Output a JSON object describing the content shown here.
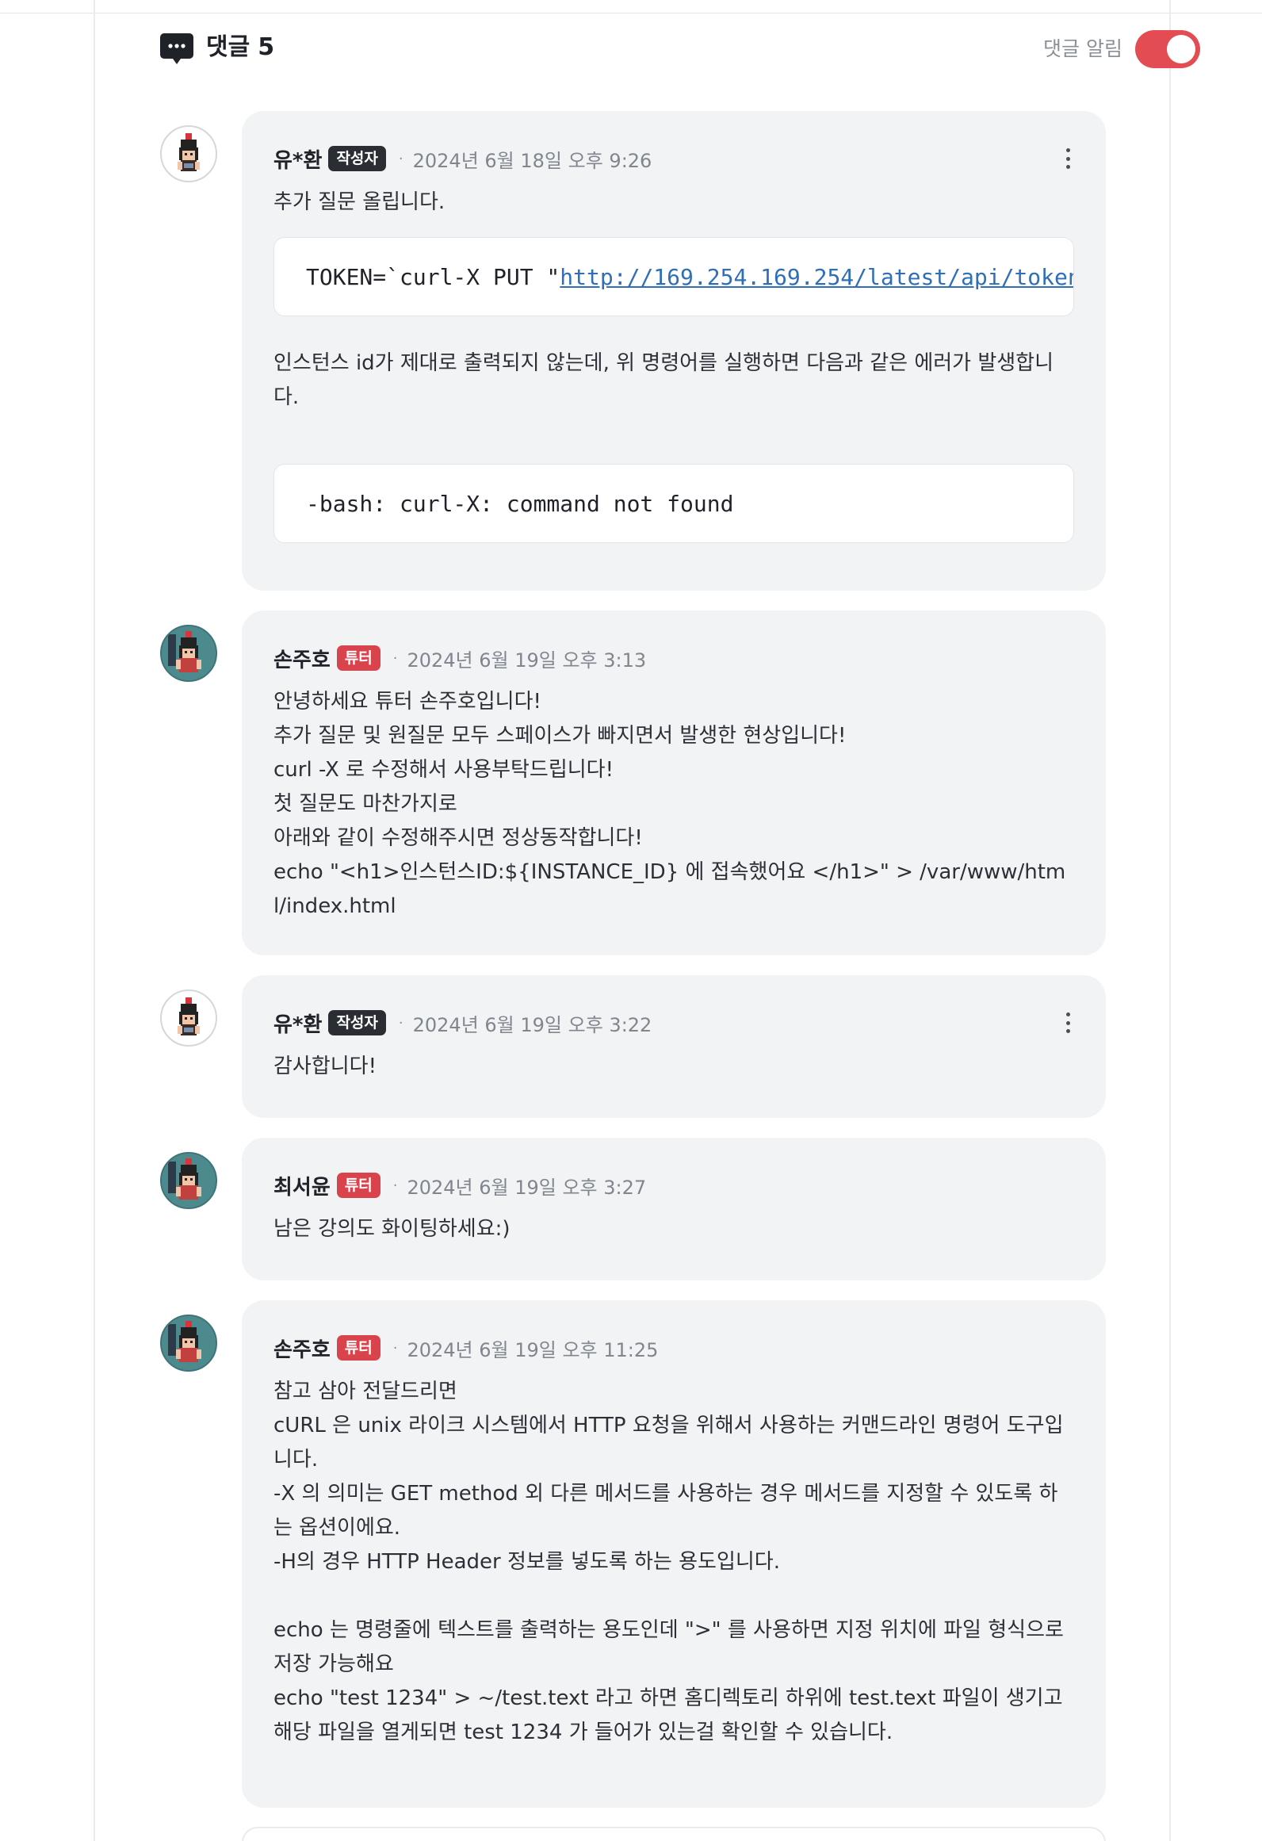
{
  "header": {
    "title": "댓글",
    "count": "5",
    "notify_label": "댓글 알림",
    "notify_on": true,
    "accent": "#e24c52"
  },
  "comments": [
    {
      "name": "유*환",
      "badge": "작성자",
      "date": "2024년 6월 18일 오후 9:26",
      "text": "추가 질문 올립니다.",
      "code1_prefix": "TOKEN=`curl-X PUT \"",
      "code1_url": "http://169.254.169.254/latest/api/token",
      "mid_text": "인스턴스 id가 제대로 출력되지 않는데, 위 명령어를 실행하면 다음과 같은 에러가 발생합니다.",
      "code2": "-bash: curl-X: command not found"
    },
    {
      "name": "손주호",
      "badge": "튜터",
      "date": "2024년 6월 19일 오후 3:13",
      "text": "안녕하세요 튜터 손주호입니다!\n추가 질문 및 원질문 모두 스페이스가 빠지면서 발생한 현상입니다!\ncurl -X 로 수정해서 사용부탁드립니다!\n첫 질문도 마찬가지로\n아래와 같이 수정해주시면 정상동작합니다!\necho \"<h1>인스턴스ID:${INSTANCE_ID} 에 접속했어요 </h1>\" > /var/www/html/index.html"
    },
    {
      "name": "유*환",
      "badge": "작성자",
      "date": "2024년 6월 19일 오후 3:22",
      "text": "감사합니다!"
    },
    {
      "name": "최서윤",
      "badge": "튜터",
      "date": "2024년 6월 19일 오후 3:27",
      "text": "남은 강의도 화이팅하세요:)"
    },
    {
      "name": "손주호",
      "badge": "튜터",
      "date": "2024년 6월 19일 오후 11:25",
      "text": "참고 삼아 전달드리면\ncURL 은 unix 라이크 시스템에서 HTTP 요청을 위해서 사용하는 커맨드라인 명령어 도구입니다.\n-X 의 의미는 GET method 외 다른 메서드를 사용하는 경우 메서드를 지정할 수 있도록 하는 옵션이에요.\n-H의 경우 HTTP Header 정보를 넣도록 하는 용도입니다.\n\necho 는 명령줄에 텍스트를 출력하는 용도인데 \">\" 를 사용하면 지정 위치에 파일 형식으로 저장 가능해요\necho \"test 1234\" > ~/test.text 라고 하면 홈디렉토리 하위에 test.text 파일이 생기고 해당 파일을 열게되면 test 1234 가 들어가 있는걸 확인할 수 있습니다."
    }
  ]
}
